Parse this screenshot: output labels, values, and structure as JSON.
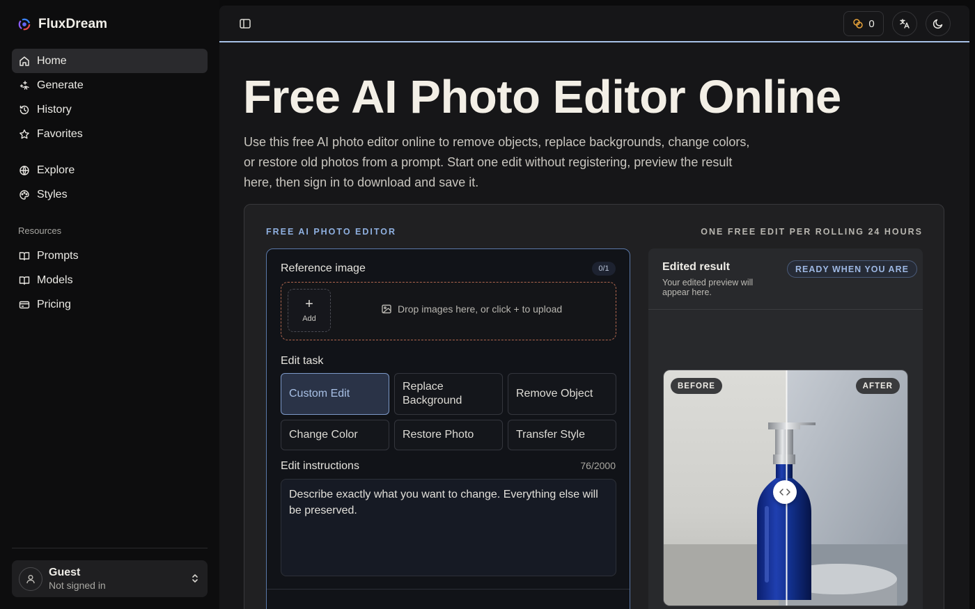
{
  "app": {
    "name": "FluxDream"
  },
  "sidebar": {
    "primary": [
      {
        "label": "Home",
        "icon": "home-icon"
      },
      {
        "label": "Generate",
        "icon": "sparkles-icon"
      },
      {
        "label": "History",
        "icon": "history-icon"
      },
      {
        "label": "Favorites",
        "icon": "star-icon"
      }
    ],
    "secondary": [
      {
        "label": "Explore",
        "icon": "globe-icon"
      },
      {
        "label": "Styles",
        "icon": "palette-icon"
      }
    ],
    "resources_label": "Resources",
    "resources": [
      {
        "label": "Prompts",
        "icon": "book-icon"
      },
      {
        "label": "Models",
        "icon": "book-icon"
      },
      {
        "label": "Pricing",
        "icon": "credit-card-icon"
      }
    ],
    "user": {
      "name": "Guest",
      "status": "Not signed in"
    }
  },
  "topbar": {
    "credits": "0"
  },
  "hero": {
    "title": "Free AI Photo Editor Online",
    "description": "Use this free AI photo editor online to remove objects, replace backgrounds, change colors, or restore old photos from a prompt. Start one edit without registering, preview the result here, then sign in to download and save it."
  },
  "editor": {
    "kicker": "FREE AI PHOTO EDITOR",
    "note": "ONE FREE EDIT PER ROLLING 24 HOURS",
    "reference_label": "Reference image",
    "reference_count": "0/1",
    "add_label": "Add",
    "drop_text": "Drop images here, or click + to upload",
    "task_label": "Edit task",
    "tasks": [
      "Custom Edit",
      "Replace Background",
      "Remove Object",
      "Change Color",
      "Restore Photo",
      "Transfer Style"
    ],
    "active_task": "Custom Edit",
    "instructions_label": "Edit instructions",
    "instructions_counter": "76/2000",
    "instructions_text": "Describe exactly what you want to change. Everything else will be preserved."
  },
  "result": {
    "title": "Edited result",
    "subtitle": "Your edited preview will appear here.",
    "status_pill": "READY WHEN YOU ARE",
    "before_label": "BEFORE",
    "after_label": "AFTER"
  },
  "colors": {
    "accent": "#8fb0e0",
    "active_task_bg": "#2a3347",
    "dropzone_border": "#b0664e",
    "credits_icon": "#e8a33a"
  }
}
